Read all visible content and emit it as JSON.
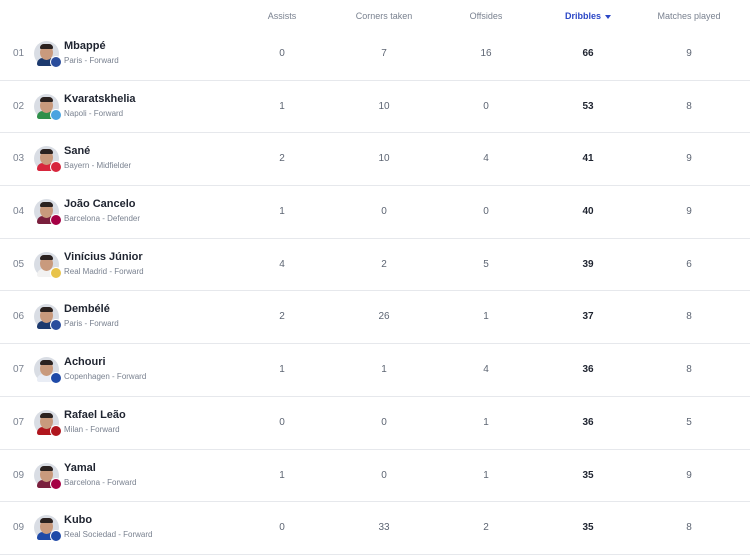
{
  "headers": [
    {
      "label": "Assists",
      "sorted": false
    },
    {
      "label": "Corners taken",
      "sorted": false
    },
    {
      "label": "Offsides",
      "sorted": false
    },
    {
      "label": "Dribbles",
      "sorted": true
    },
    {
      "label": "Matches played",
      "sorted": false
    }
  ],
  "colors": {
    "accent": "#2b47c6",
    "muted": "#7a8290",
    "divider": "#e6e8ec"
  },
  "rows": [
    {
      "rank": "01",
      "name": "Mbappé",
      "sub": "Paris - Forward",
      "assists": "0",
      "corners": "7",
      "offsides": "16",
      "dribbles": "66",
      "matches": "9",
      "shirt": "#1d3a6e",
      "badge": "#2a4d9c"
    },
    {
      "rank": "02",
      "name": "Kvaratskhelia",
      "sub": "Napoli - Forward",
      "assists": "1",
      "corners": "10",
      "offsides": "0",
      "dribbles": "53",
      "matches": "8",
      "shirt": "#2f8f4a",
      "badge": "#4aa3e0"
    },
    {
      "rank": "03",
      "name": "Sané",
      "sub": "Bayern - Midfielder",
      "assists": "2",
      "corners": "10",
      "offsides": "4",
      "dribbles": "41",
      "matches": "9",
      "shirt": "#d7263d",
      "badge": "#d7263d"
    },
    {
      "rank": "04",
      "name": "João Cancelo",
      "sub": "Barcelona - Defender",
      "assists": "1",
      "corners": "0",
      "offsides": "0",
      "dribbles": "40",
      "matches": "9",
      "shirt": "#7a1f3d",
      "badge": "#a50044"
    },
    {
      "rank": "05",
      "name": "Vinícius Júnior",
      "sub": "Real Madrid - Forward",
      "assists": "4",
      "corners": "2",
      "offsides": "5",
      "dribbles": "39",
      "matches": "6",
      "shirt": "#f2f2f2",
      "badge": "#e8c34a"
    },
    {
      "rank": "06",
      "name": "Dembélé",
      "sub": "Paris - Forward",
      "assists": "2",
      "corners": "26",
      "offsides": "1",
      "dribbles": "37",
      "matches": "8",
      "shirt": "#1d3a6e",
      "badge": "#2a4d9c"
    },
    {
      "rank": "07",
      "name": "Achouri",
      "sub": "Copenhagen - Forward",
      "assists": "1",
      "corners": "1",
      "offsides": "4",
      "dribbles": "36",
      "matches": "8",
      "shirt": "#e9edf5",
      "badge": "#1f4aa8"
    },
    {
      "rank": "07",
      "name": "Rafael Leão",
      "sub": "Milan - Forward",
      "assists": "0",
      "corners": "0",
      "offsides": "1",
      "dribbles": "36",
      "matches": "5",
      "shirt": "#b0161e",
      "badge": "#b0161e"
    },
    {
      "rank": "09",
      "name": "Yamal",
      "sub": "Barcelona - Forward",
      "assists": "1",
      "corners": "0",
      "offsides": "1",
      "dribbles": "35",
      "matches": "9",
      "shirt": "#7a1f3d",
      "badge": "#a50044"
    },
    {
      "rank": "09",
      "name": "Kubo",
      "sub": "Real Sociedad - Forward",
      "assists": "0",
      "corners": "33",
      "offsides": "2",
      "dribbles": "35",
      "matches": "8",
      "shirt": "#1f4aa8",
      "badge": "#1f4aa8"
    }
  ]
}
